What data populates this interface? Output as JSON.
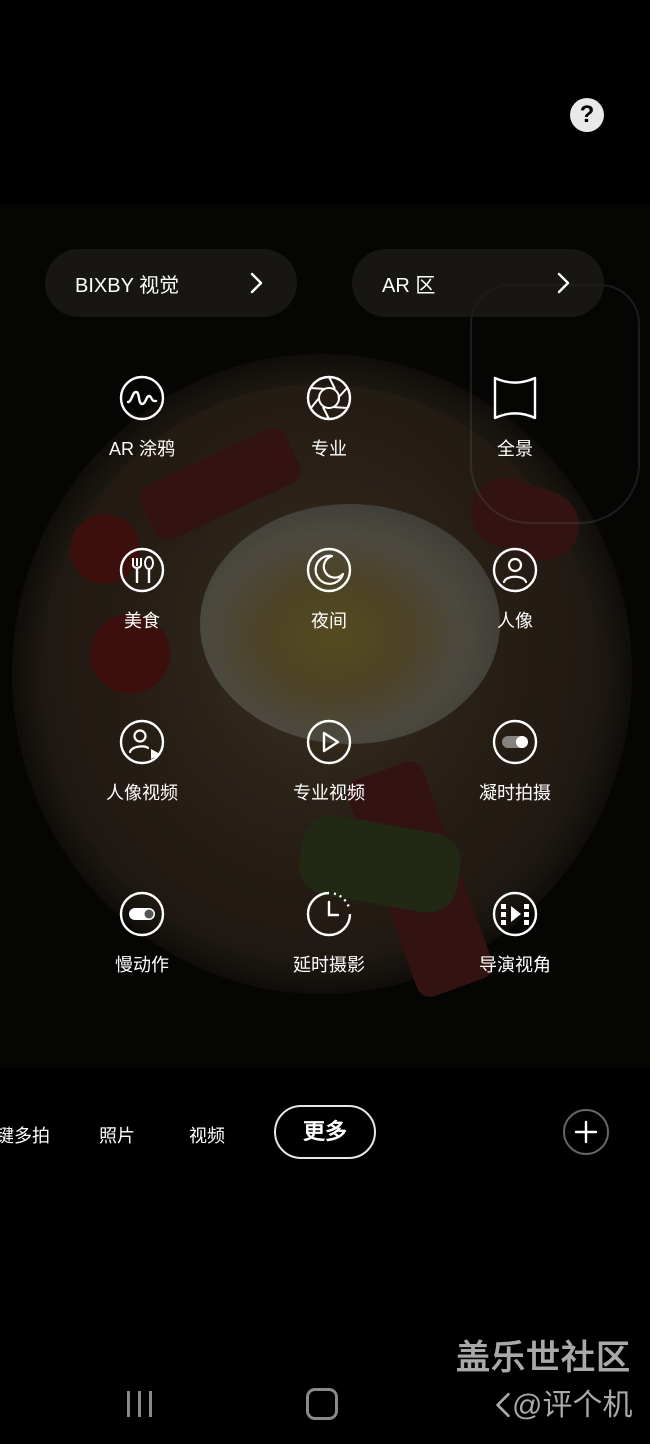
{
  "top": {
    "help_label": "?"
  },
  "quick_links": [
    {
      "label": "BIXBY 视觉"
    },
    {
      "label": "AR 区"
    }
  ],
  "modes": [
    {
      "label": "AR 涂鸦",
      "icon": "ar-doodle-icon"
    },
    {
      "label": "专业",
      "icon": "aperture-icon"
    },
    {
      "label": "全景",
      "icon": "panorama-icon"
    },
    {
      "label": "美食",
      "icon": "food-icon"
    },
    {
      "label": "夜间",
      "icon": "moon-icon"
    },
    {
      "label": "人像",
      "icon": "portrait-icon"
    },
    {
      "label": "人像视频",
      "icon": "portrait-video-icon"
    },
    {
      "label": "专业视频",
      "icon": "play-icon"
    },
    {
      "label": "凝时拍摄",
      "icon": "hyperlapse-toggle-icon"
    },
    {
      "label": "慢动作",
      "icon": "slow-motion-toggle-icon"
    },
    {
      "label": "延时摄影",
      "icon": "timelapse-clock-icon"
    },
    {
      "label": "导演视角",
      "icon": "directors-view-icon"
    }
  ],
  "mode_tabs": {
    "single_take": "键多拍",
    "photo": "照片",
    "video": "视频",
    "more": "更多"
  },
  "watermark": {
    "line1": "盖乐世社区",
    "line2": "@评个机"
  }
}
